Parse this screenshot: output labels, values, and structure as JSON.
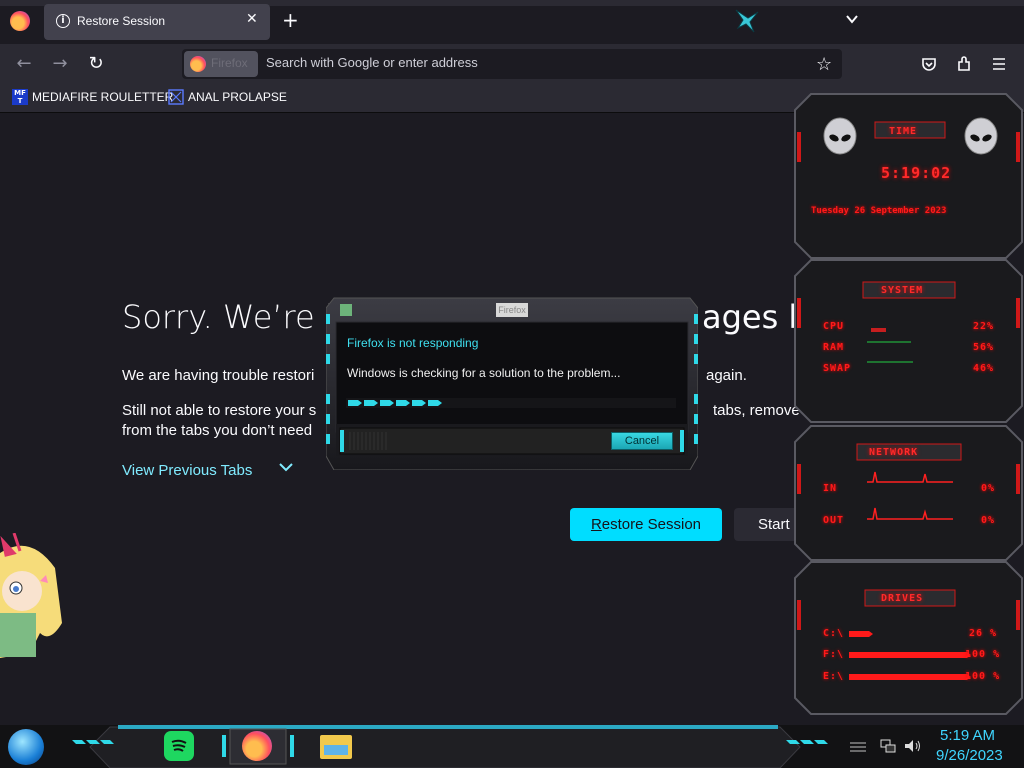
{
  "tab": {
    "title": "Restore Session",
    "close": "✕"
  },
  "newtab": "+",
  "nav": {
    "back": "←",
    "forward": "→",
    "reload": "↻",
    "identity_label": "Firefox",
    "url_placeholder": "Search with Google or enter address"
  },
  "bookmarks": [
    {
      "label": "MEDIAFIRE ROULETTER",
      "icon": "MF"
    },
    {
      "label": "ANAL PROLAPSE",
      "icon": "ksmart"
    }
  ],
  "page": {
    "heading_left": "Sorry. We’re h",
    "heading_right": "ages ba",
    "para1_left": "We are having trouble restori",
    "para1_right": "again.",
    "para2_line1_left": "Still not able to restore your s",
    "para2_line1_right": "tabs, remove t",
    "para2_line2_left": "from the tabs you don’t need",
    "view_previous": "View Previous Tabs",
    "restore_button": "Restore Session",
    "restore_accesskey": "R",
    "restore_rest": "estore Session",
    "start_button": "Start"
  },
  "dialog": {
    "title": "Firefox",
    "heading": "Firefox is not responding",
    "text": "Windows is checking for a solution to the problem...",
    "cancel": "Cancel"
  },
  "gadgets": {
    "time": {
      "title": "TIME",
      "clock": "5:19:02",
      "date": "Tuesday 26 September 2023"
    },
    "system": {
      "title": "SYSTEM",
      "rows": [
        {
          "label": "CPU",
          "value": "22%"
        },
        {
          "label": "RAM",
          "value": "56%"
        },
        {
          "label": "SWAP",
          "value": "46%"
        }
      ]
    },
    "network": {
      "title": "NETWORK",
      "rows": [
        {
          "label": "IN",
          "value": "0%"
        },
        {
          "label": "OUT",
          "value": "0%"
        }
      ]
    },
    "drives": {
      "title": "DRIVES",
      "rows": [
        {
          "label": "C:\\",
          "value": "26 %"
        },
        {
          "label": "F:\\",
          "value": "100 %"
        },
        {
          "label": "E:\\",
          "value": "100 %"
        }
      ]
    }
  },
  "taskbar": {
    "apps": [
      "spotify-app",
      "firefox-app",
      "file-explorer-app"
    ],
    "clock_time": "5:19 AM",
    "clock_date": "9/26/2023"
  },
  "colors": {
    "accent": "#00ddff",
    "gadget_red": "#ff1a1a",
    "clock": "#3fd6ff"
  }
}
